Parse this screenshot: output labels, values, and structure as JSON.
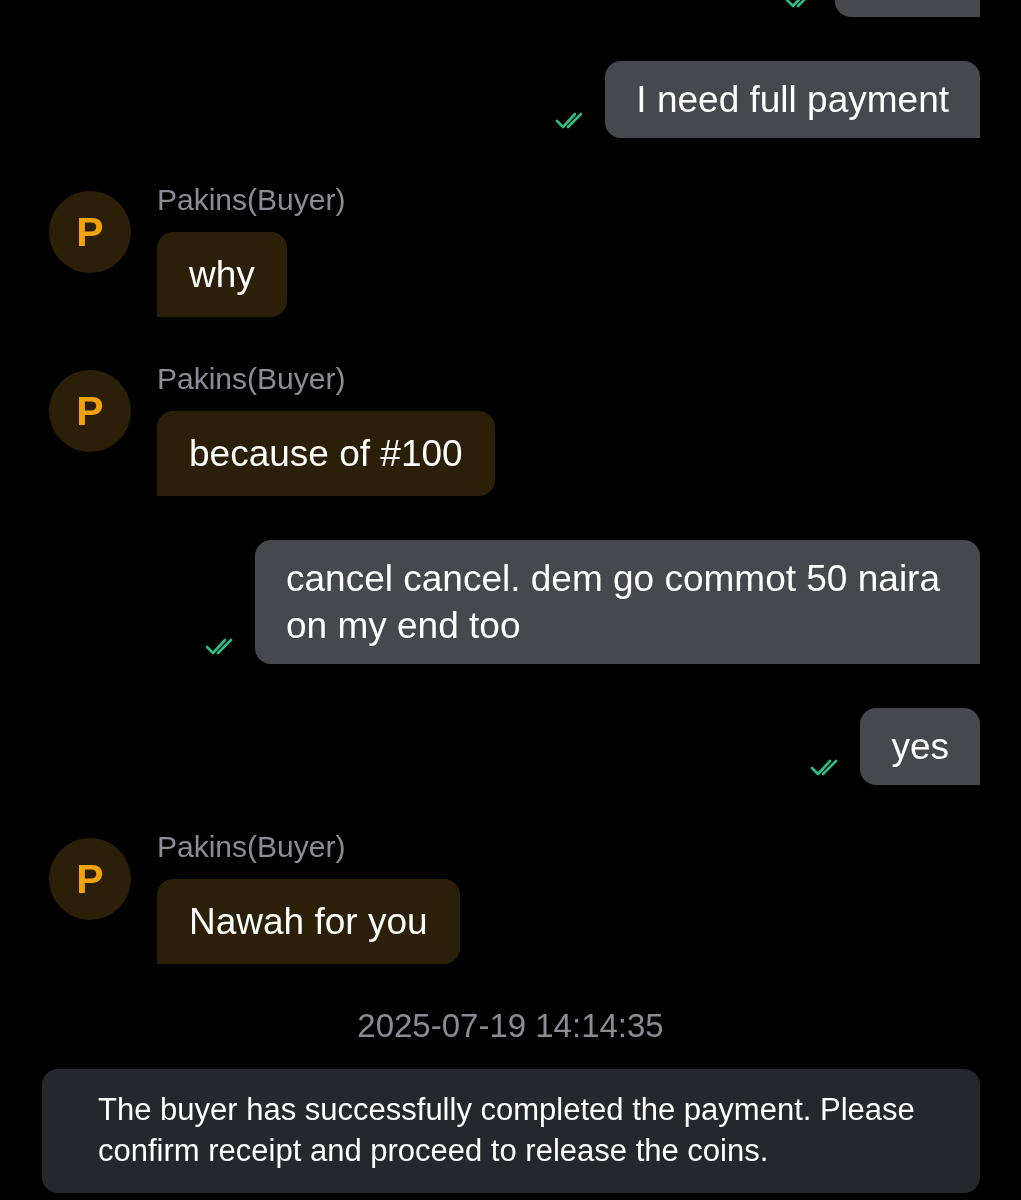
{
  "messages": [
    {
      "kind": "sent",
      "delivered": true
    },
    {
      "kind": "sent",
      "text": "I need full payment",
      "delivered": true
    },
    {
      "kind": "received",
      "sender": "Pakins(Buyer)",
      "avatar_letter": "P",
      "text": "why"
    },
    {
      "kind": "received",
      "sender": "Pakins(Buyer)",
      "avatar_letter": "P",
      "text": "because of #100"
    },
    {
      "kind": "sent",
      "text": "cancel cancel. dem go commot 50 naira on my end too",
      "delivered": true
    },
    {
      "kind": "sent",
      "text": "yes",
      "delivered": true
    },
    {
      "kind": "received",
      "sender": "Pakins(Buyer)",
      "avatar_letter": "P",
      "text": "Nawah for you"
    }
  ],
  "timestamp": "2025-07-19 14:14:35",
  "system_notice": "The buyer has successfully completed the payment. Please confirm receipt and proceed to release the coins."
}
